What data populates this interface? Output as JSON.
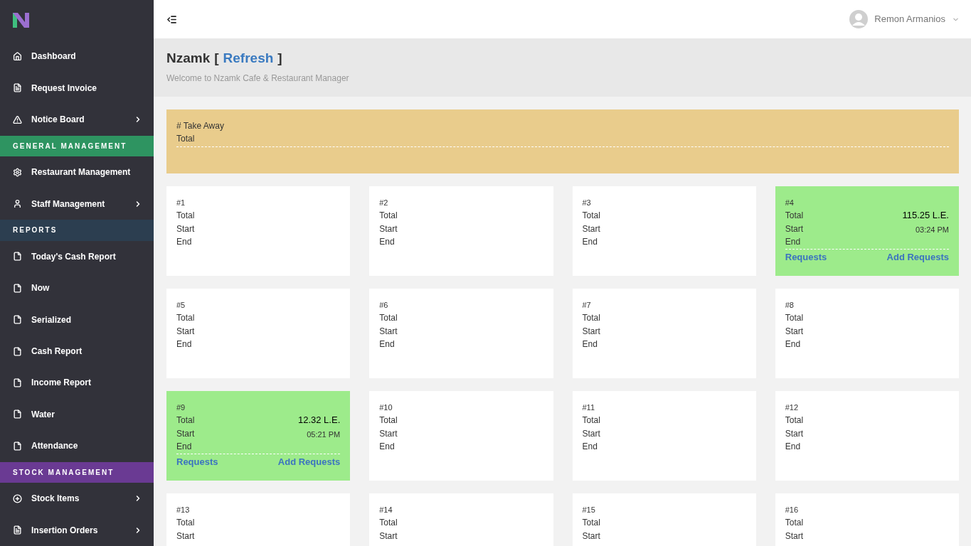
{
  "sidebar": {
    "items": [
      {
        "kind": "item",
        "label": "Dashboard",
        "expandable": false
      },
      {
        "kind": "item",
        "label": "Request Invoice",
        "expandable": false
      },
      {
        "kind": "item",
        "label": "Notice Board",
        "expandable": true
      },
      {
        "kind": "section",
        "label": "GENERAL MANAGEMENT",
        "color": "#2e9461"
      },
      {
        "kind": "item",
        "label": "Restaurant Management",
        "expandable": false
      },
      {
        "kind": "item",
        "label": "Staff Management",
        "expandable": true
      },
      {
        "kind": "section",
        "label": "REPORTS",
        "color": "#2c3e50"
      },
      {
        "kind": "item",
        "label": "Today's Cash Report",
        "expandable": false
      },
      {
        "kind": "item",
        "label": "Now",
        "expandable": false
      },
      {
        "kind": "item",
        "label": "Serialized",
        "expandable": false
      },
      {
        "kind": "item",
        "label": "Cash Report",
        "expandable": false
      },
      {
        "kind": "item",
        "label": "Income Report",
        "expandable": false
      },
      {
        "kind": "item",
        "label": "Water",
        "expandable": false
      },
      {
        "kind": "item",
        "label": "Attendance",
        "expandable": false
      },
      {
        "kind": "section",
        "label": "STOCK MANAGEMENT",
        "color": "#6a3a93"
      },
      {
        "kind": "item",
        "label": "Stock Items",
        "expandable": true
      },
      {
        "kind": "item",
        "label": "Insertion Orders",
        "expandable": true
      }
    ]
  },
  "header": {
    "user": "Remon Armanios"
  },
  "page": {
    "title": "Nzamk",
    "bracket_open": "[",
    "refresh": "Refresh",
    "bracket_close": "]",
    "subtitle": "Welcome to Nzamk Cafe & Restaurant Manager"
  },
  "take_away": {
    "title": "# Take Away",
    "total_label": "Total"
  },
  "tables": [
    {
      "number": "#1",
      "labels": [
        "Total",
        "Start",
        "End"
      ],
      "occupied": false
    },
    {
      "number": "#2",
      "labels": [
        "Total",
        "Start",
        "End"
      ],
      "occupied": false
    },
    {
      "number": "#3",
      "labels": [
        "Total",
        "Start",
        "End"
      ],
      "occupied": false
    },
    {
      "number": "#4",
      "labels": [
        "Total",
        "Start",
        "End"
      ],
      "occupied": true,
      "total": "115.25 L.E.",
      "start": "03:24 PM",
      "links": [
        "Requests",
        "Add Requests"
      ]
    },
    {
      "number": "#5",
      "labels": [
        "Total",
        "Start",
        "End"
      ],
      "occupied": false
    },
    {
      "number": "#6",
      "labels": [
        "Total",
        "Start",
        "End"
      ],
      "occupied": false
    },
    {
      "number": "#7",
      "labels": [
        "Total",
        "Start",
        "End"
      ],
      "occupied": false
    },
    {
      "number": "#8",
      "labels": [
        "Total",
        "Start",
        "End"
      ],
      "occupied": false
    },
    {
      "number": "#9",
      "labels": [
        "Total",
        "Start",
        "End"
      ],
      "occupied": true,
      "total": "12.32 L.E.",
      "start": "05:21 PM",
      "links": [
        "Requests",
        "Add Requests"
      ]
    },
    {
      "number": "#10",
      "labels": [
        "Total",
        "Start",
        "End"
      ],
      "occupied": false
    },
    {
      "number": "#11",
      "labels": [
        "Total",
        "Start",
        "End"
      ],
      "occupied": false
    },
    {
      "number": "#12",
      "labels": [
        "Total",
        "Start",
        "End"
      ],
      "occupied": false
    },
    {
      "number": "#13",
      "labels": [
        "Total",
        "Start"
      ],
      "occupied": false
    },
    {
      "number": "#14",
      "labels": [
        "Total",
        "Start"
      ],
      "occupied": false
    },
    {
      "number": "#15",
      "labels": [
        "Total",
        "Start"
      ],
      "occupied": false
    },
    {
      "number": "#16",
      "labels": [
        "Total",
        "Start"
      ],
      "occupied": false
    }
  ]
}
